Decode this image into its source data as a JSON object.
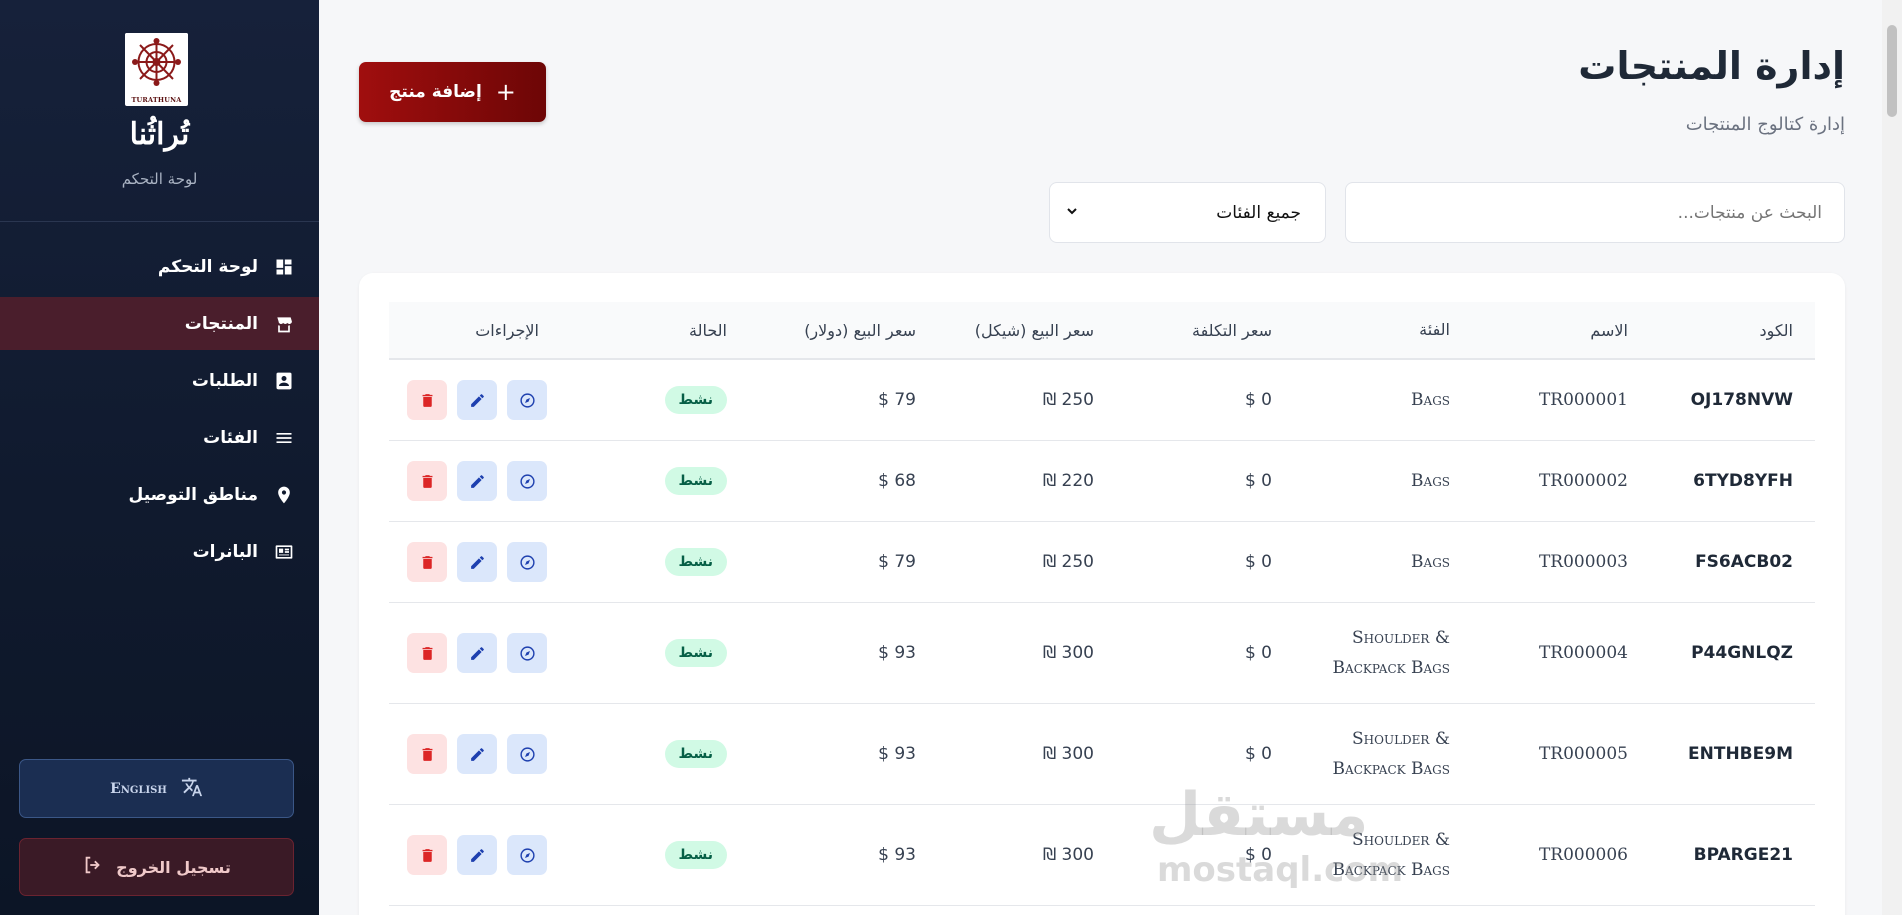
{
  "sidebar": {
    "brand_name": "تُراثُنا",
    "logo_text": "TURATHUNA",
    "subtitle": "لوحة التحكم",
    "nav": [
      {
        "label": "لوحة التحكم",
        "icon": "dashboard-icon",
        "active": false
      },
      {
        "label": "المنتجات",
        "icon": "store-icon",
        "active": true
      },
      {
        "label": "الطلبات",
        "icon": "contact-card-icon",
        "active": false
      },
      {
        "label": "الفئات",
        "icon": "list-icon",
        "active": false
      },
      {
        "label": "مناطق التوصيل",
        "icon": "location-pin-icon",
        "active": false
      },
      {
        "label": "البانرات",
        "icon": "banner-icon",
        "active": false
      }
    ],
    "language_button": "English",
    "logout_button": "تسجيل الخروج"
  },
  "header": {
    "title": "إدارة المنتجات",
    "subtitle": "إدارة كتالوج المنتجات",
    "add_button": "إضافة منتج",
    "add_icon": "+"
  },
  "filters": {
    "search_placeholder": "البحث عن منتجات...",
    "category_selected": "جميع الفئات"
  },
  "table": {
    "columns": [
      "الكود",
      "الاسم",
      "الفئة",
      "سعر التكلفة",
      "سعر البيع (شيكل)",
      "سعر البيع (دولار)",
      "الحالة",
      "الإجراءات"
    ],
    "rows": [
      {
        "code": "OJ178NVW",
        "name": "TR000001",
        "category": "Bags",
        "cost": "$ 0",
        "price_ils": "₪ 250",
        "price_usd": "$ 79",
        "status": "نشط"
      },
      {
        "code": "6TYD8YFH",
        "name": "TR000002",
        "category": "Bags",
        "cost": "$ 0",
        "price_ils": "₪ 220",
        "price_usd": "$ 68",
        "status": "نشط"
      },
      {
        "code": "FS6ACB02",
        "name": "TR000003",
        "category": "Bags",
        "cost": "$ 0",
        "price_ils": "₪ 250",
        "price_usd": "$ 79",
        "status": "نشط"
      },
      {
        "code": "P44GNLQZ",
        "name": "TR000004",
        "category": "Shoulder & Backpack Bags",
        "cost": "$ 0",
        "price_ils": "₪ 300",
        "price_usd": "$ 93",
        "status": "نشط"
      },
      {
        "code": "ENTHBE9M",
        "name": "TR000005",
        "category": "Shoulder & Backpack Bags",
        "cost": "$ 0",
        "price_ils": "₪ 300",
        "price_usd": "$ 93",
        "status": "نشط"
      },
      {
        "code": "BPARGE21",
        "name": "TR000006",
        "category": "Shoulder & Backpack Bags",
        "cost": "$ 0",
        "price_ils": "₪ 300",
        "price_usd": "$ 93",
        "status": "نشط"
      }
    ]
  },
  "watermark": {
    "main": "مستقل",
    "sub": "mostaql.com"
  },
  "colors": {
    "sidebar_bg": "#16213a",
    "active_nav": "#4a1e2c",
    "primary_button": "#a00e0e",
    "status_bg": "#d1fae5",
    "status_text": "#065f46"
  }
}
